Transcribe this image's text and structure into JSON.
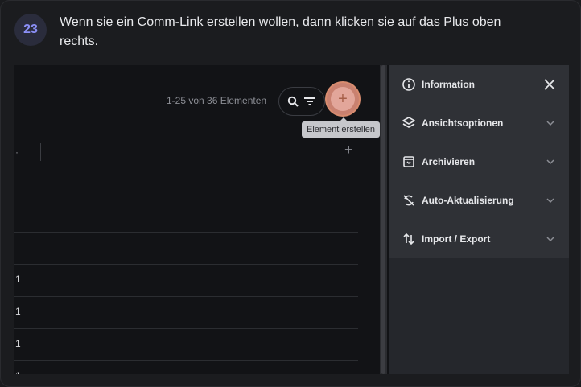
{
  "step": {
    "number": "23"
  },
  "instruction": "Wenn sie ein Comm-Link erstellen wollen, dann klicken sie auf das Plus oben rechts.",
  "toolbar": {
    "count_text": "1-25 von 36 Elementen",
    "add_tooltip": "Element erstellen"
  },
  "table": {
    "rows": [
      "",
      "",
      "",
      "1",
      "1",
      "1",
      "1"
    ]
  },
  "panel": {
    "items": [
      {
        "label": "Information",
        "icon": "info-icon"
      },
      {
        "label": "Ansichtsoptionen",
        "icon": "layers-icon"
      },
      {
        "label": "Archivieren",
        "icon": "archive-icon"
      },
      {
        "label": "Auto-Aktualisierung",
        "icon": "refresh-off-icon"
      },
      {
        "label": "Import / Export",
        "icon": "import-export-icon"
      }
    ]
  },
  "colors": {
    "accent": "#8b8ff6",
    "add_button": "#c98170",
    "tooltip_bg": "#c6c7cb"
  }
}
